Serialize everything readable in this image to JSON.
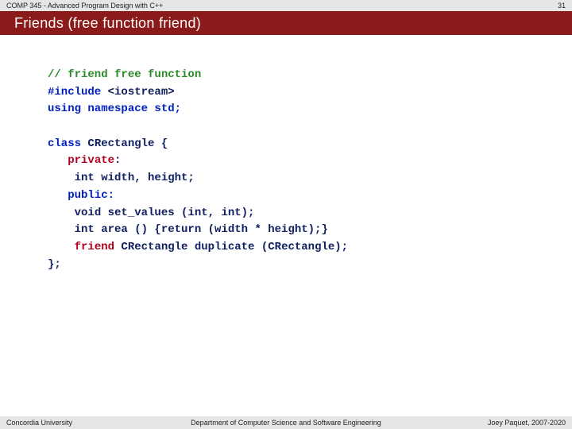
{
  "topbar": {
    "course": "COMP 345 - Advanced Program Design with C++",
    "slide_number": "31"
  },
  "titlebar": {
    "title": "Friends (free function friend)"
  },
  "code": {
    "l1_comment": "// friend free function",
    "l2_include_kw": "#include",
    "l2_include_arg": " <iostream>",
    "l3_using": "using namespace std;",
    "l4_class_kw": "class",
    "l4_class_rest": " CRectangle {",
    "l5_indent": "   ",
    "l5_private": "private",
    "l5_colon": ":",
    "l6_indent": "    ",
    "l6_decl": "int width, height;",
    "l7_indent": "   ",
    "l7_public": "public:",
    "l8_indent": "    ",
    "l8_setvals": "void set_values (int, int);",
    "l9_indent": "    ",
    "l9_area": "int area () {return (width * height);}",
    "l10_indent": "    ",
    "l10_friend_kw": "friend",
    "l10_friend_rest": " CRectangle duplicate (CRectangle);",
    "l11_close": "};"
  },
  "bottombar": {
    "left": "Concordia University",
    "center": "Department of Computer Science and Software Engineering",
    "right": "Joey Paquet, 2007-2020"
  }
}
